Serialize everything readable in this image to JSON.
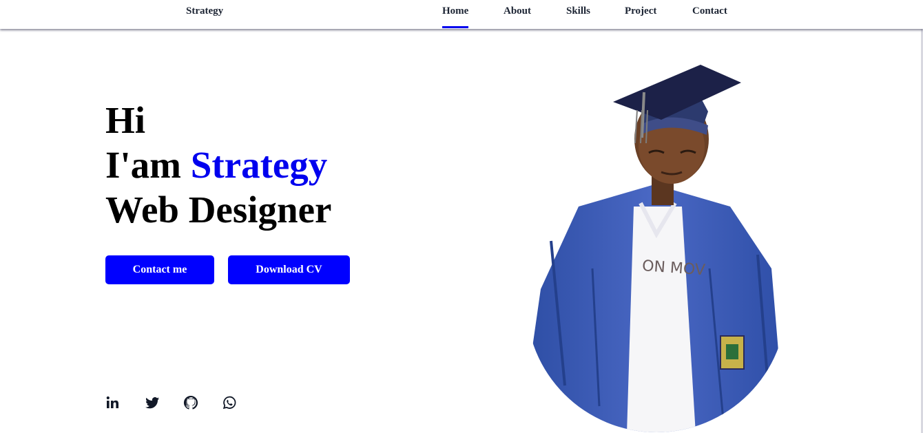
{
  "header": {
    "logo": "Strategy",
    "nav": [
      {
        "label": "Home",
        "active": true
      },
      {
        "label": "About",
        "active": false
      },
      {
        "label": "Skills",
        "active": false
      },
      {
        "label": "Project",
        "active": false
      },
      {
        "label": "Contact",
        "active": false
      }
    ]
  },
  "hero": {
    "line1": "Hi",
    "line2_prefix": "I'am ",
    "line2_name": "Strategy",
    "line3": "Web Designer",
    "contact_button": "Contact me",
    "cv_button": "Download CV",
    "photo_shirt_text": "ON MOV",
    "socials": [
      {
        "icon": "linkedin-icon"
      },
      {
        "icon": "twitter-icon"
      },
      {
        "icon": "github-icon"
      },
      {
        "icon": "whatsapp-icon"
      }
    ]
  },
  "colors": {
    "accent": "#0000ee",
    "button": "#0000ff",
    "text": "#1c2433",
    "gown": "#3d5bb5"
  }
}
